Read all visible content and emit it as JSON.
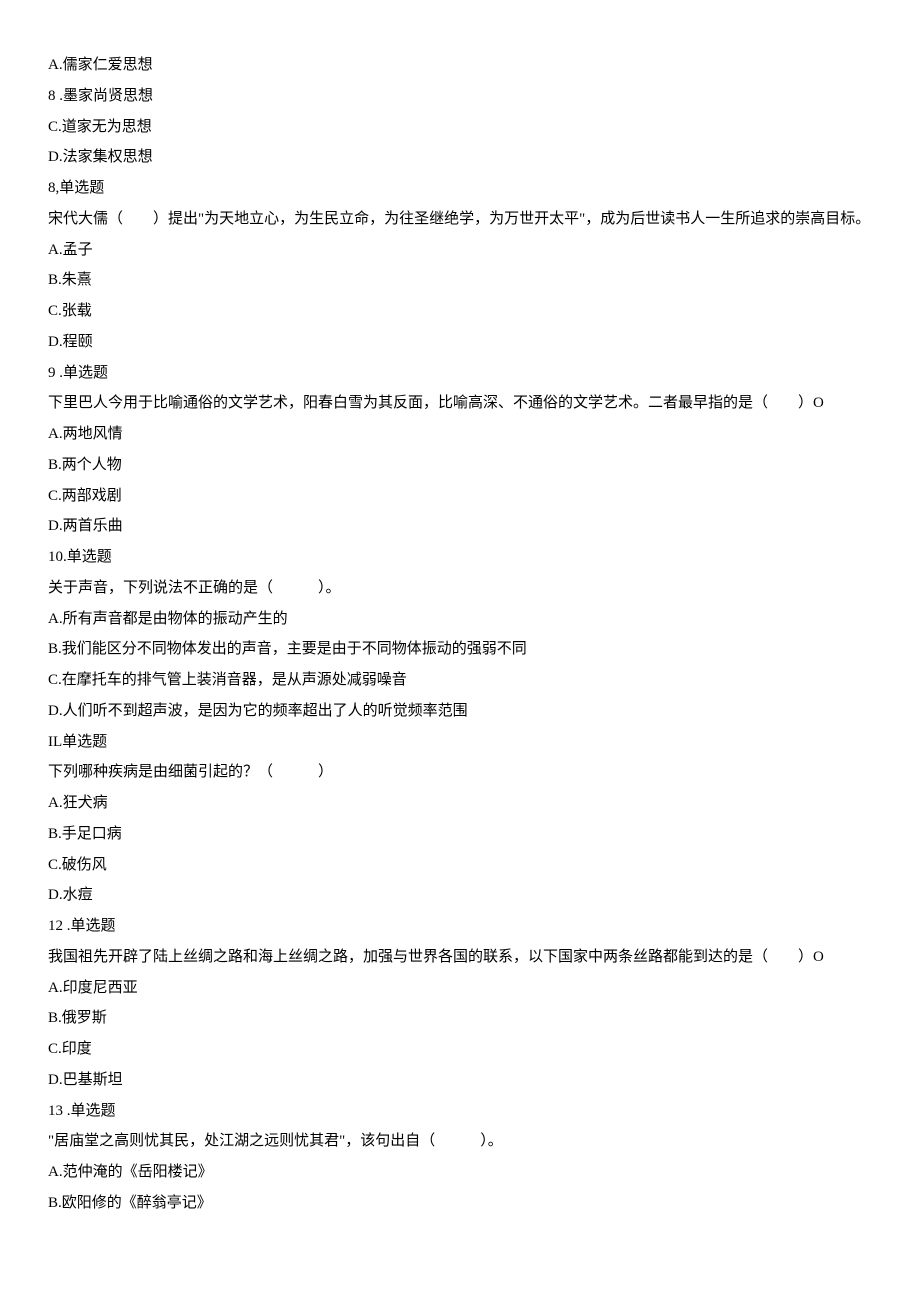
{
  "lines": [
    "A.儒家仁爱思想",
    "8 .墨家尚贤思想",
    "C.道家无为思想",
    "D.法家集权思想",
    "8,单选题",
    "宋代大儒（　　）提出\"为天地立心，为生民立命，为往圣继绝学，为万世开太平\"，成为后世读书人一生所追求的崇高目标。",
    "A.孟子",
    "B.朱熹",
    "C.张载",
    "D.程颐",
    "9 .单选题",
    "下里巴人今用于比喻通俗的文学艺术，阳春白雪为其反面，比喻高深、不通俗的文学艺术。二者最早指的是（　　）O",
    "A.两地风情",
    "B.两个人物",
    "C.两部戏剧",
    "D.两首乐曲",
    "10.单选题",
    "关于声音，下列说法不正确的是（　　　）。",
    "A.所有声音都是由物体的振动产生的",
    "B.我们能区分不同物体发出的声音，主要是由于不同物体振动的强弱不同",
    "C.在摩托车的排气管上装消音器，是从声源处减弱噪音",
    "D.人们听不到超声波，是因为它的频率超出了人的听觉频率范围",
    "IL单选题",
    "下列哪种疾病是由细菌引起的？（　　　）",
    "A.狂犬病",
    "B.手足口病",
    "C.破伤风",
    "D.水痘",
    "12 .单选题",
    "我国祖先开辟了陆上丝绸之路和海上丝绸之路，加强与世界各国的联系，以下国家中两条丝路都能到达的是（　　）O",
    "A.印度尼西亚",
    "B.俄罗斯",
    "C.印度",
    "D.巴基斯坦",
    "13 .单选题",
    "\"居庙堂之高则忧其民，处江湖之远则忧其君\"，该句出自（　　　）。",
    "A.范仲淹的《岳阳楼记》",
    "B.欧阳修的《醉翁亭记》"
  ]
}
